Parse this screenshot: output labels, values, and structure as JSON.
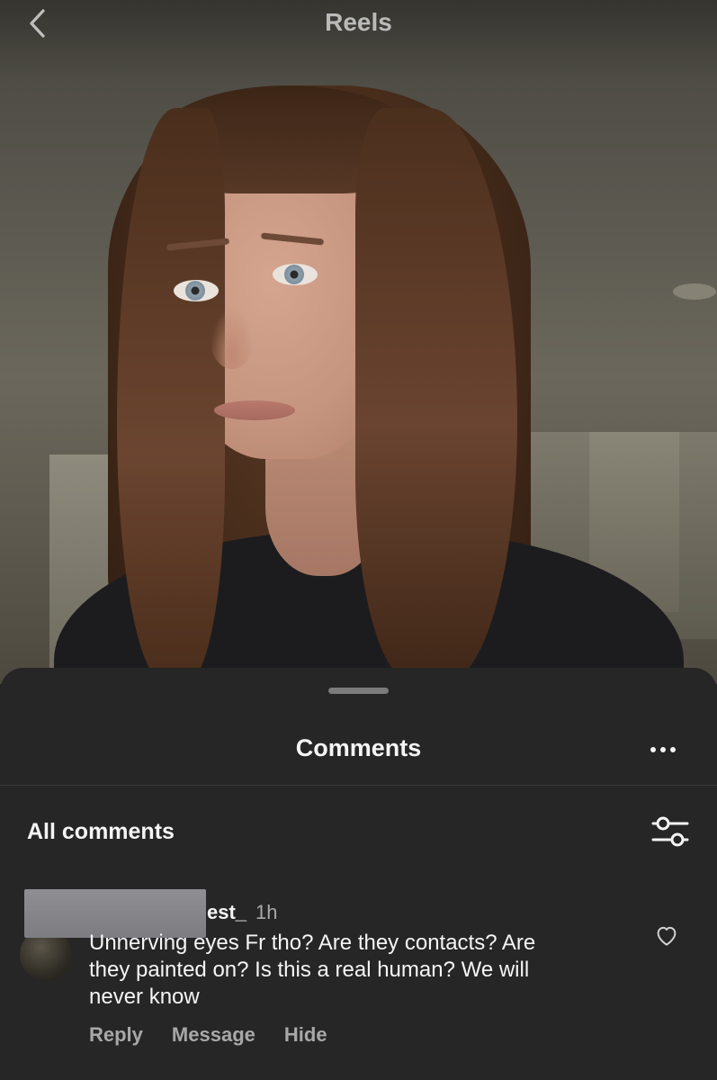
{
  "header": {
    "title": "Reels",
    "back_icon": "chevron-left-icon"
  },
  "sheet": {
    "title": "Comments",
    "more_icon": "more-horizontal-icon",
    "section_label": "All comments",
    "filter_icon": "sliders-icon"
  },
  "comments": [
    {
      "username": "est_",
      "time": "1h",
      "text": "Unnerving eyes Fr tho? Are they contacts? Are\nthey painted on? Is this a real human? We will\nnever know",
      "actions": [
        "Reply",
        "Message",
        "Hide"
      ],
      "like_icon": "heart-outline-icon"
    }
  ],
  "colors": {
    "sheet_bg": "#262626",
    "text_primary": "#f5f5f5",
    "text_secondary": "#a8a8a8",
    "grabber": "#7b7b7b"
  }
}
